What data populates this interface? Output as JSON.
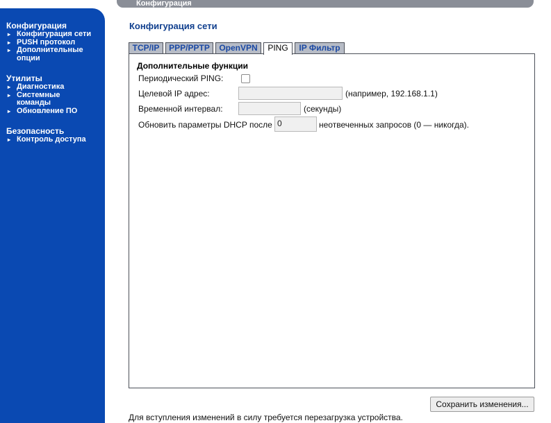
{
  "header": {
    "title": "Конфигурация"
  },
  "sidebar": {
    "sections": [
      {
        "heading": "Конфигурация",
        "items": [
          {
            "label": "Конфигурация сети"
          },
          {
            "label": "PUSH протокол"
          },
          {
            "label": "Дополнительные опции"
          }
        ]
      },
      {
        "heading": "Утилиты",
        "items": [
          {
            "label": "Диагностика"
          },
          {
            "label": "Системные команды"
          },
          {
            "label": "Обновление ПО"
          }
        ]
      },
      {
        "heading": "Безопасность",
        "items": [
          {
            "label": "Контроль доступа"
          }
        ]
      }
    ]
  },
  "main": {
    "title": "Конфигурация сети",
    "tabs": [
      {
        "label": "TCP/IP",
        "active": false
      },
      {
        "label": "PPP/PPTP",
        "active": false
      },
      {
        "label": "OpenVPN",
        "active": false
      },
      {
        "label": "PING",
        "active": true
      },
      {
        "label": "IP Фильтр",
        "active": false
      }
    ],
    "panel": {
      "heading": "Дополнительные функции",
      "periodic_ping_label": "Периодический PING:",
      "periodic_ping_checked": false,
      "target_ip_label": "Целевой IP адрес:",
      "target_ip_value": "",
      "target_ip_hint": "(например, 192.168.1.1)",
      "interval_label": "Временной интервал:",
      "interval_value": "",
      "interval_hint": "(секунды)",
      "dhcp_prefix": "Обновить параметры DHCP после",
      "dhcp_value": "0",
      "dhcp_suffix": "неотвеченных запросов (0 — никогда)."
    },
    "save_label": "Сохранить изменения...",
    "footer_note": "Для вступления изменений в силу требуется перезагрузка устройства."
  },
  "colors": {
    "sidebar_bg": "#0a49b2",
    "title_color": "#103f8e",
    "tab_bg": "#b7bcc6",
    "topbar_bg": "#8a8e97"
  }
}
